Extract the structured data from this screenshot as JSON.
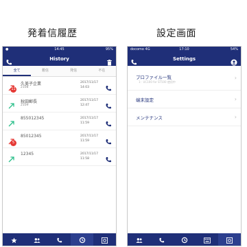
{
  "captions": {
    "left": "発着信履歴",
    "right": "設定画面"
  },
  "history_screen": {
    "status": {
      "left": "●",
      "time": "14:45",
      "right": "95%"
    },
    "title": "History",
    "tabs": [
      "全て",
      "着信",
      "発信",
      "不在"
    ],
    "rows": [
      {
        "name": "久美子企業",
        "sub": "2108",
        "date": "2017/11/17",
        "time": "14:03",
        "badge": "11",
        "arrow_color": "#e53935"
      },
      {
        "name": "秋田郵長",
        "sub": "2109",
        "date": "2017/11/17",
        "time": "12:47",
        "badge": "",
        "arrow_color": "#2bbf8a"
      },
      {
        "name": "855012345",
        "sub": "",
        "date": "2017/11/17",
        "time": "11:59",
        "badge": "",
        "arrow_color": "#2bbf8a"
      },
      {
        "name": "85012345",
        "sub": "",
        "date": "2017/11/17",
        "time": "11:59",
        "badge": "5",
        "arrow_color": "#e53935"
      },
      {
        "name": "12345",
        "sub": "",
        "date": "2017/11/17",
        "time": "11:58",
        "badge": "",
        "arrow_color": "#2bbf8a"
      }
    ],
    "bottom_nav": [
      "star-icon",
      "contacts-icon",
      "phone-icon",
      "history-icon",
      "settings-icon"
    ]
  },
  "settings_screen": {
    "status": {
      "left": "docomo 4G",
      "time": "17:10",
      "right": "54%"
    },
    "title": "Settings",
    "items": [
      {
        "label": "プロファイル一覧",
        "sub": "1：UC100 for ST500 使用中"
      },
      {
        "label": "端末設定",
        "sub": ""
      },
      {
        "label": "メンテナンス",
        "sub": ""
      }
    ],
    "bottom_nav": [
      "contacts-icon",
      "phone-icon",
      "history-icon",
      "keypad-icon",
      "settings-icon"
    ]
  },
  "colors": {
    "navy": "#1f2f78",
    "red": "#e53935",
    "green": "#2bbf8a"
  }
}
